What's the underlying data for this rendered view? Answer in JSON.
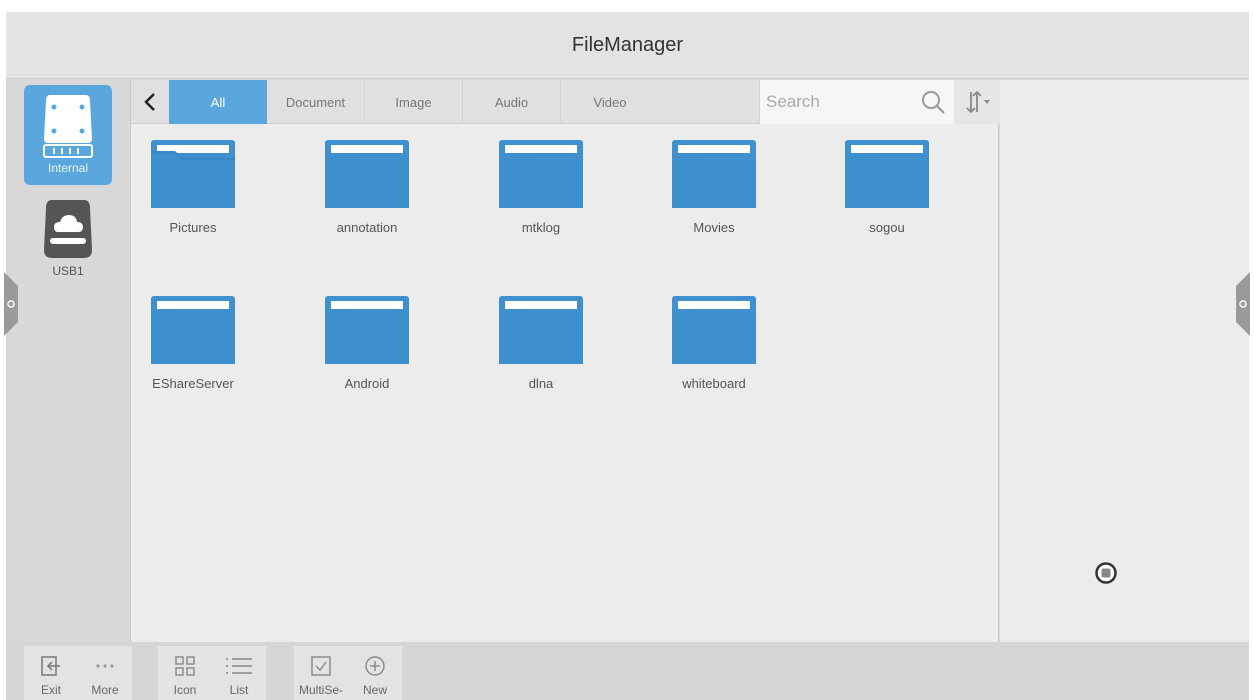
{
  "app": {
    "title": "FileManager"
  },
  "drives": [
    {
      "label": "Internal",
      "selected": true
    },
    {
      "label": "USB1",
      "selected": false
    }
  ],
  "tabs": [
    {
      "label": "All",
      "active": true
    },
    {
      "label": "Document",
      "active": false
    },
    {
      "label": "Image",
      "active": false
    },
    {
      "label": "Audio",
      "active": false
    },
    {
      "label": "Video",
      "active": false
    }
  ],
  "search": {
    "placeholder": "Search",
    "value": ""
  },
  "folders": [
    {
      "name": "Pictures"
    },
    {
      "name": "annotation"
    },
    {
      "name": "mtklog"
    },
    {
      "name": "Movies"
    },
    {
      "name": "sogou"
    },
    {
      "name": "EShareServer"
    },
    {
      "name": "Android"
    },
    {
      "name": "dlna"
    },
    {
      "name": "whiteboard"
    }
  ],
  "toolbar": {
    "exit_label": "Exit",
    "more_label": "More",
    "icon_label": "Icon",
    "list_label": "List",
    "multiselect_label": "MultiSe-",
    "new_label": "New"
  },
  "colors": {
    "accent": "#5aa7de",
    "folder": "#3e90cf",
    "background": "#ececec"
  },
  "icons": {
    "back": "chevron-left-icon",
    "search": "magnifier-icon",
    "sort": "sort-arrows-icon",
    "folder": "folder-icon",
    "internal_drive": "hard-drive-icon",
    "usb_drive": "cloud-drive-icon"
  }
}
